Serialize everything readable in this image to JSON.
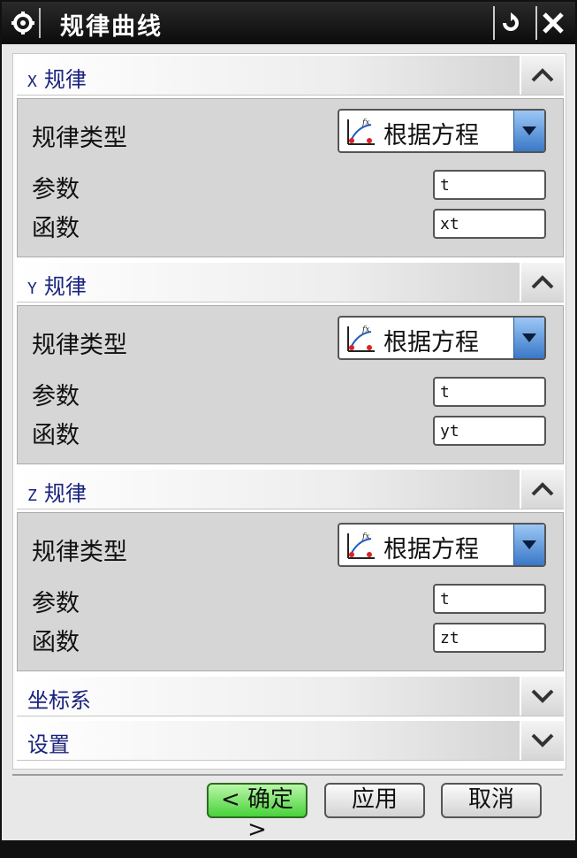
{
  "window": {
    "title": "规律曲线"
  },
  "sections": [
    {
      "axis": "X",
      "title": "规律",
      "expanded": true,
      "law_type_label": "规律类型",
      "law_type_value": "根据方程",
      "param_label": "参数",
      "param_value": "t",
      "func_label": "函数",
      "func_value": "xt"
    },
    {
      "axis": "Y",
      "title": "规律",
      "expanded": true,
      "law_type_label": "规律类型",
      "law_type_value": "根据方程",
      "param_label": "参数",
      "param_value": "t",
      "func_label": "函数",
      "func_value": "yt"
    },
    {
      "axis": "Z",
      "title": "规律",
      "expanded": true,
      "law_type_label": "规律类型",
      "law_type_value": "根据方程",
      "param_label": "参数",
      "param_value": "t",
      "func_label": "函数",
      "func_value": "zt"
    }
  ],
  "collapsed_sections": [
    {
      "title": "坐标系",
      "expanded": false
    },
    {
      "title": "设置",
      "expanded": false
    }
  ],
  "buttons": {
    "ok": "< 确定 >",
    "apply": "应用",
    "cancel": "取消"
  },
  "colors": {
    "ok_button": "#49d23a",
    "dropdown_arrow": "#3a78c8",
    "section_title": "#1a237e"
  }
}
